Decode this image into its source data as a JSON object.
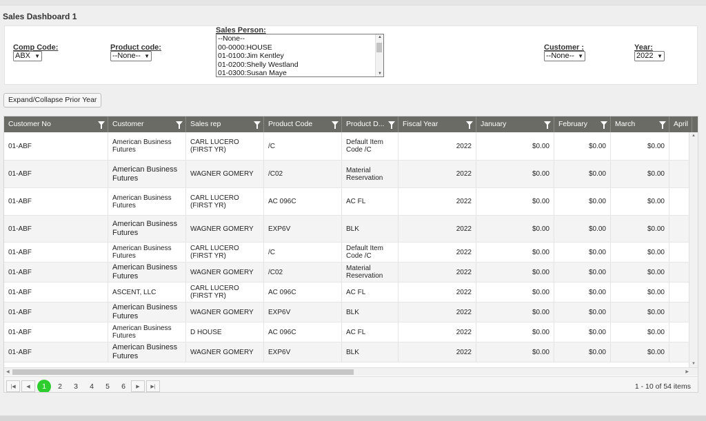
{
  "page": {
    "title": "Sales Dashboard 1"
  },
  "filters": {
    "comp_code": {
      "label": "Comp Code:",
      "value": "ABX"
    },
    "product_code": {
      "label": "Product code:",
      "value": "--None--"
    },
    "sales_person": {
      "label": "Sales Person:",
      "options": [
        "--None--",
        "00-0000:HOUSE",
        "01-0100:Jim Kentley",
        "01-0200:Shelly Westland",
        "01-0300:Susan Maye"
      ]
    },
    "customer": {
      "label": "Customer :",
      "value": "--None--"
    },
    "year": {
      "label": "Year:",
      "value": "2022"
    }
  },
  "toolbar": {
    "expand_label": "Expand/Collapse Prior Year"
  },
  "grid": {
    "columns": [
      "Customer No",
      "Customer",
      "Sales rep",
      "Product Code",
      "Product D...",
      "Fiscal Year",
      "January",
      "February",
      "March",
      "April"
    ],
    "rows": [
      [
        "01-ABF",
        "American Business Futures",
        "CARL LUCERO (FIRST YR)",
        "/C",
        "Default Item Code /C",
        "2022",
        "$0.00",
        "$0.00",
        "$0.00"
      ],
      [
        "01-ABF",
        "American Business Futures",
        "WAGNER GOMERY",
        "/C02",
        "Material Reservation",
        "2022",
        "$0.00",
        "$0.00",
        "$0.00"
      ],
      [
        "01-ABF",
        "American Business Futures",
        "CARL LUCERO (FIRST YR)",
        "AC 096C",
        "AC FL",
        "2022",
        "$0.00",
        "$0.00",
        "$0.00"
      ],
      [
        "01-ABF",
        "American Business Futures",
        "WAGNER GOMERY",
        "EXP6V",
        "BLK",
        "2022",
        "$0.00",
        "$0.00",
        "$0.00"
      ],
      [
        "01-ABF",
        "American Business Futures",
        "CARL LUCERO (FIRST YR)",
        "/C",
        "Default Item Code /C",
        "2022",
        "$0.00",
        "$0.00",
        "$0.00"
      ],
      [
        "01-ABF",
        "American Business Futures",
        "WAGNER GOMERY",
        "/C02",
        "Material Reservation",
        "2022",
        "$0.00",
        "$0.00",
        "$0.00"
      ],
      [
        "01-ABF",
        "ASCENT, LLC",
        "CARL LUCERO (FIRST YR)",
        "AC 096C",
        "AC FL",
        "2022",
        "$0.00",
        "$0.00",
        "$0.00"
      ],
      [
        "01-ABF",
        "American Business Futures",
        "WAGNER GOMERY",
        "EXP6V",
        "BLK",
        "2022",
        "$0.00",
        "$0.00",
        "$0.00"
      ],
      [
        "01-ABF",
        "American Business Futures",
        "D HOUSE",
        "AC 096C",
        "AC FL",
        "2022",
        "$0.00",
        "$0.00",
        "$0.00"
      ],
      [
        "01-ABF",
        "American Business Futures",
        "WAGNER GOMERY",
        "EXP6V",
        "BLK",
        "2022",
        "$0.00",
        "$0.00",
        "$0.00"
      ]
    ]
  },
  "pager": {
    "pages": [
      "1",
      "2",
      "3",
      "4",
      "5",
      "6"
    ],
    "current_page": "1",
    "info": "1 - 10 of 54 items"
  },
  "colors": {
    "header_bg": "#6b6b65",
    "active_page": "#2ecc2e"
  }
}
